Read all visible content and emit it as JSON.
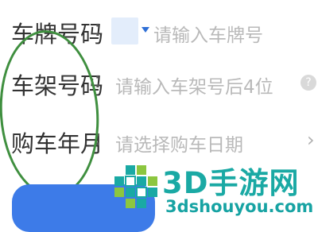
{
  "form": {
    "plate": {
      "label": "车牌号码",
      "colon": ":",
      "placeholder": "请输入车牌号"
    },
    "frame": {
      "label": "车架号码",
      "colon": ":",
      "placeholder": "请输入车架号后4位",
      "help_glyph": "?"
    },
    "date": {
      "label": "购车年月",
      "colon": ":",
      "placeholder": "请选择购车日期",
      "chevron_glyph": "›"
    }
  },
  "watermark": {
    "title": "3D手游网",
    "domain": "3dshouyou.com"
  },
  "colors": {
    "accent_blue": "#3d7be8",
    "circle_green": "#3f8f3f",
    "watermark_teal": "#1aa9a4"
  }
}
